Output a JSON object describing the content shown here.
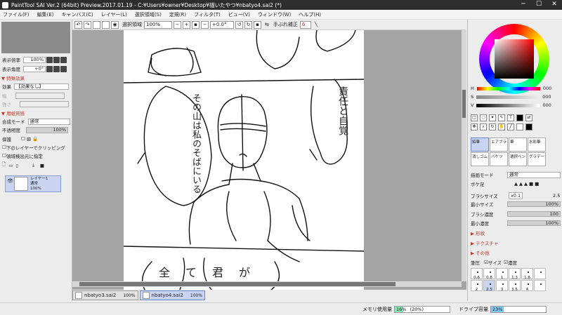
{
  "window": {
    "title": "PaintTool SAI Ver.2 (64bit) Preview.2017.01.19 - C:¥Users¥owner¥Desktop¥描いたやつ¥nbatyo4.sai2 (*)",
    "minimize": "─",
    "maximize": "☐",
    "close": "✕"
  },
  "menu": [
    "ファイル(F)",
    "編集(E)",
    "キャンバス(C)",
    "レイヤー(L)",
    "選択領域(S)",
    "定規(R)",
    "フィルタ(T)",
    "ビュー(V)",
    "ウィンドウ(W)",
    "ヘルプ(H)"
  ],
  "toolbar": {
    "selection_label": "選択領域",
    "zoom": "100%",
    "angle": "+0.0°",
    "stabilizer_label": "手ぶれ補正",
    "stabilizer_value": "6"
  },
  "left": {
    "zoom_label": "表示倍率",
    "zoom_value": "100%",
    "angle_label": "表示角度",
    "angle_value": "+0°",
    "effects_head": "▼ 特殊効果",
    "effect_label": "効果",
    "effect_value": "【効果なし】",
    "effect_width_label": "幅",
    "effect_strength_label": "強さ",
    "paper_head": "▼ 用紙質感",
    "blend_label": "合成モード",
    "blend_value": "通常",
    "opacity_label": "不透明度",
    "opacity_value": "100%",
    "protect_label": "保護",
    "clip_label": "下のレイヤーでクリッピング",
    "selsource_label": "領域検出元に指定",
    "layer_name": "レイヤー1",
    "layer_mode": "通常",
    "layer_opacity": "100%"
  },
  "tabs": [
    {
      "name": "nbatyo3.sai2",
      "pct": "100%"
    },
    {
      "name": "nbatyo4.sai2",
      "pct": "100%"
    }
  ],
  "status": {
    "memory_label": "メモリ使用量",
    "memory_value": "16%",
    "memory_paren": "(20%)",
    "memory_fill": 0.16,
    "drive_label": "ドライブ容量",
    "drive_value": "23%",
    "drive_fill": 0.23
  },
  "right": {
    "h_label": "H",
    "h_value": "000",
    "s_label": "S",
    "s_value": "000",
    "v_label": "V",
    "v_value": "000",
    "text_tool": "T",
    "brushes": [
      "鉛筆",
      "エアブラシ",
      "筆",
      "水彩筆",
      "消しゴム",
      "バケツ",
      "選択ペン",
      "グラデーション"
    ],
    "draw_mode_label": "描画モード",
    "draw_mode_value": "通常",
    "edge_label": "ボケ足",
    "brush_size_label": "ブラシサイズ",
    "brush_size_mult": "x0.1",
    "brush_size_value": "2.5",
    "min_size_label": "最小サイズ",
    "min_size_value": "100%",
    "density_label": "ブラシ濃度",
    "density_value": "100",
    "min_density_label": "最小濃度",
    "min_density_value": "100%",
    "shape_head": "▶ 形状",
    "texture_head": "▶ テクスチャ",
    "other_head": "▶ その他",
    "pressure_label": "筆圧",
    "pressure_size": "サイズ",
    "pressure_density": "濃度",
    "sizes": [
      "0.6",
      "0.8",
      "1",
      "1.3",
      "1.6",
      "",
      "2",
      "2.5",
      "3",
      "3.5",
      "4",
      ""
    ]
  },
  "canvas": {
    "bubble_left_text": "その山は私のそばにいる",
    "bubble_right_text": "責任と自覚",
    "bottom_text": "全て君が"
  }
}
